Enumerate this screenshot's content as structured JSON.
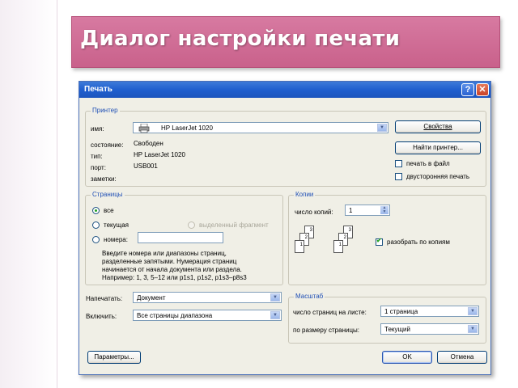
{
  "slide": {
    "title": "Диалог настройки печати"
  },
  "dialog": {
    "title": "Печать",
    "help_glyph": "?",
    "close_glyph": "✕",
    "printer": {
      "legend": "Принтер",
      "name_label": "имя:",
      "name_value": "HP LaserJet 1020",
      "status_label": "состояние:",
      "status_value": "Свободен",
      "type_label": "тип:",
      "type_value": "HP LaserJet 1020",
      "port_label": "порт:",
      "port_value": "USB001",
      "notes_label": "заметки:",
      "properties_button": "Свойства",
      "find_printer_button": "Найти принтер...",
      "print_to_file_label": "печать в файл",
      "duplex_label": "двусторонняя печать"
    },
    "pages": {
      "legend": "Страницы",
      "all_label": "все",
      "current_label": "текущая",
      "selection_label": "выделенный фрагмент",
      "numbers_label": "номера:",
      "numbers_value": "",
      "help_text": [
        "Введите номера или диапазоны страниц,",
        "разделенные запятыми. Нумерация страниц",
        "начинается от начала документа или раздела.",
        "Например: 1, 3, 5–12 или p1s1, p1s2, p1s3–p8s3"
      ],
      "selected": "all"
    },
    "copies": {
      "legend": "Копии",
      "count_label": "число копий:",
      "count_value": "1",
      "collate_label": "разобрать по копиям",
      "collate_checked": true,
      "sheet_numbers": [
        "3",
        "2",
        "1"
      ]
    },
    "print_what": {
      "label": "Напечатать:",
      "value": "Документ"
    },
    "include": {
      "label": "Включить:",
      "value": "Все страницы диапазона"
    },
    "zoom": {
      "legend": "Масштаб",
      "pages_per_sheet_label": "число страниц на листе:",
      "pages_per_sheet_value": "1 страница",
      "scale_to_label": "по размеру страницы:",
      "scale_to_value": "Текущий"
    },
    "buttons": {
      "options": "Параметры...",
      "ok": "OK",
      "cancel": "Отмена"
    }
  },
  "colors": {
    "accent": "#c9618b",
    "titlebar": "#1f5fcf",
    "group_legend": "#1f4fb5"
  }
}
